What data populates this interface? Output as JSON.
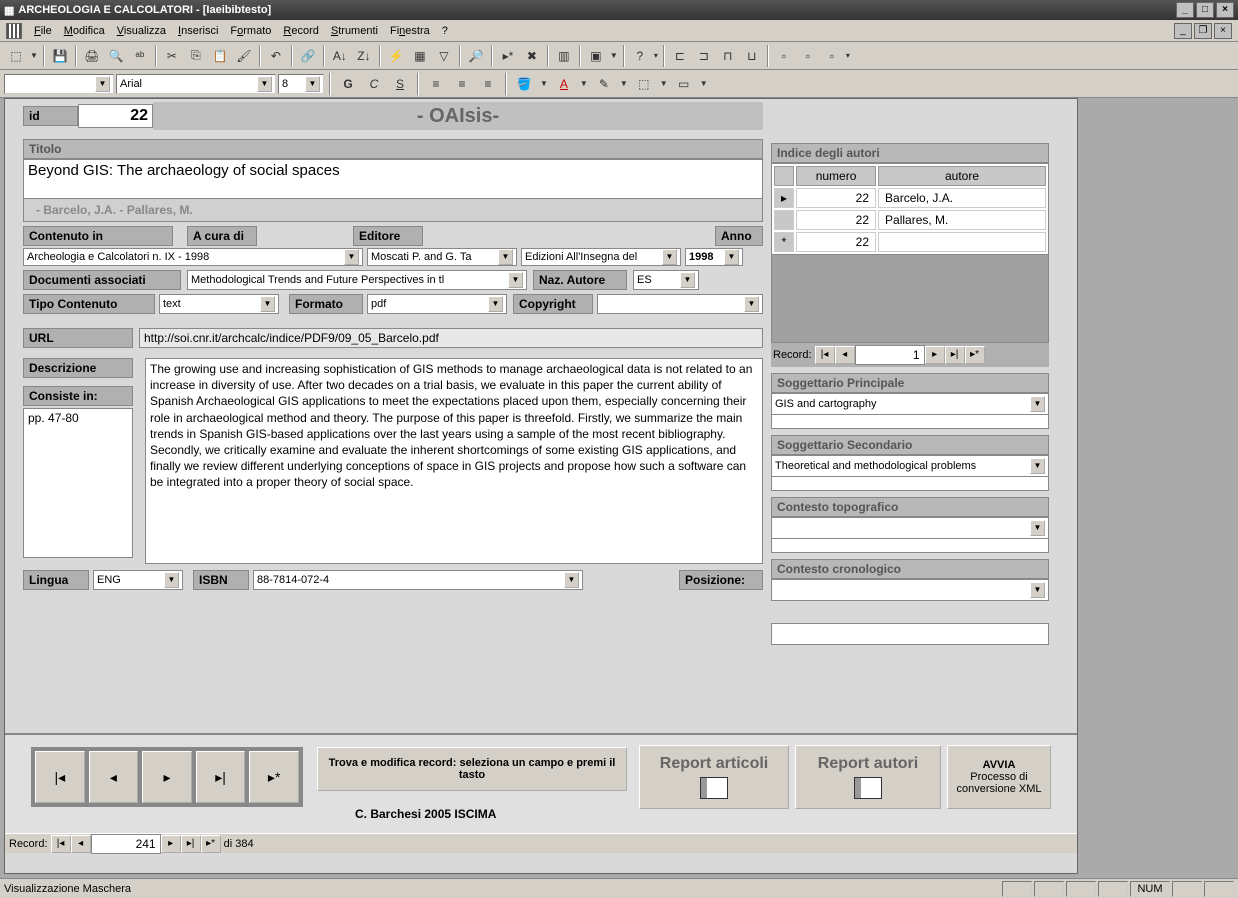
{
  "title": "ARCHEOLOGIA E CALCOLATORI - [Iaeibibtesto]",
  "menu": {
    "file": "File",
    "modifica": "Modifica",
    "visualizza": "Visualizza",
    "inserisci": "Inserisci",
    "formato": "Formato",
    "record": "Record",
    "strumenti": "Strumenti",
    "finestra": "Finestra",
    "help": "?"
  },
  "font": {
    "name": "Arial",
    "size": "8"
  },
  "header": {
    "id_lab": "id",
    "id_val": "22",
    "app": "- OAIsis-"
  },
  "lab": {
    "titolo": "Titolo",
    "contenuto": "Contenuto in",
    "acura": "A cura di",
    "editore": "Editore",
    "anno": "Anno",
    "docass": "Documenti associati",
    "naz": "Naz. Autore",
    "tipocont": "Tipo Contenuto",
    "formato": "Formato",
    "copyright": "Copyright",
    "url": "URL",
    "descr": "Descrizione",
    "consiste": "Consiste in:",
    "lingua": "Lingua",
    "isbn": "ISBN",
    "posizione": "Posizione:",
    "indice": "Indice degli autori",
    "numero": "numero",
    "autore": "autore",
    "record": "Record:",
    "sogg1": "Soggettario Principale",
    "sogg2": "Soggettario Secondario",
    "topo": "Contesto topografico",
    "crono": "Contesto cronologico"
  },
  "val": {
    "titolo": "Beyond GIS: The archaeology of social spaces",
    "authors": "- Barcelo, J.A. - Pallares, M.",
    "contenuto": "Archeologia e Calcolatori n. IX - 1998",
    "acura": "Moscati P. and G. Ta",
    "editore": "Edizioni All'Insegna del",
    "anno": "1998",
    "docass": "Methodological Trends and Future Perspectives in tl",
    "naz": "ES",
    "tipocont": "text",
    "formato": "pdf",
    "copyright": "",
    "url": "http://soi.cnr.it/archcalc/indice/PDF9/09_05_Barcelo.pdf",
    "consiste": "pp. 47-80",
    "descr": "The growing use and increasing sophistication of GIS methods to manage archaeological data is not related to an increase in diversity of use. After two decades on a trial basis, we evaluate in this paper the current ability of Spanish Archaeological GIS applications to meet the expectations placed upon them, especially concerning their role in archaeological method and theory. The purpose of this paper is threefold. Firstly, we summarize the main trends in Spanish GIS-based applications over the last years using a sample of the most recent bibliography. Secondly, we critically examine and evaluate the inherent shortcomings of some existing GIS applications, and finally we review different underlying conceptions of space in GIS projects and propose how such a software can be integrated into a proper theory of social space.",
    "lingua": "ENG",
    "isbn": "88-7814-072-4",
    "sogg1": "GIS and cartography",
    "sogg2": "Theoretical and methodological problems",
    "rec_inner": "1",
    "rec_outer": "241",
    "rec_total": "di 384"
  },
  "authors": [
    {
      "n": "22",
      "a": "Barcelo, J.A."
    },
    {
      "n": "22",
      "a": "Pallares, M."
    },
    {
      "n": "22",
      "a": ""
    }
  ],
  "buttons": {
    "trova": "Trova e modifica record: seleziona un campo e premi il tasto",
    "credit": "C. Barchesi 2005 ISCIMA",
    "rep_art": "Report articoli",
    "rep_aut": "Report autori",
    "avvia1": "AVVIA",
    "avvia2": "Processo di conversione XML"
  },
  "status": {
    "mode": "Visualizzazione Maschera",
    "num": "NUM"
  }
}
